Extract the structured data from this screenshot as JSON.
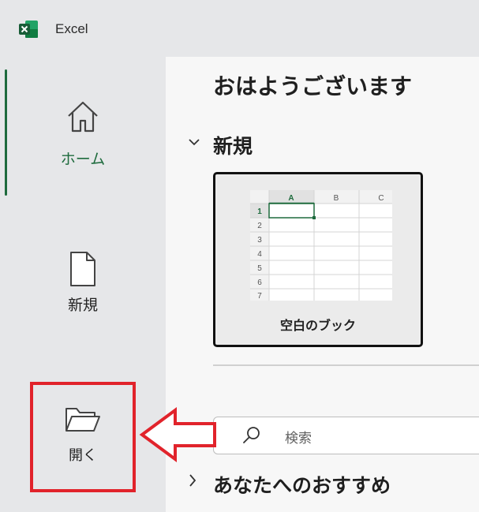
{
  "app": {
    "title": "Excel",
    "icon": "excel-logo-icon",
    "brand_color": "#1e6b3d"
  },
  "sidebar": {
    "items": [
      {
        "label": "ホーム",
        "icon": "home-icon",
        "active": true
      },
      {
        "label": "新規",
        "icon": "new-document-icon",
        "active": false
      },
      {
        "label": "開く",
        "icon": "folder-open-icon",
        "active": false
      }
    ]
  },
  "main": {
    "greeting": "おはようございます",
    "new_section": {
      "title": "新規",
      "templates": [
        {
          "label": "空白のブック",
          "preview_columns": [
            "A",
            "B",
            "C"
          ],
          "preview_rows": [
            "1",
            "2",
            "3",
            "4",
            "5",
            "6",
            "7"
          ]
        }
      ]
    },
    "search": {
      "placeholder": "検索",
      "icon": "search-icon"
    },
    "recommend_section": {
      "title": "あなたへのおすすめ"
    }
  },
  "annotations": {
    "highlight_color": "#e1232b",
    "arrow_icon": "left-arrow-icon"
  }
}
